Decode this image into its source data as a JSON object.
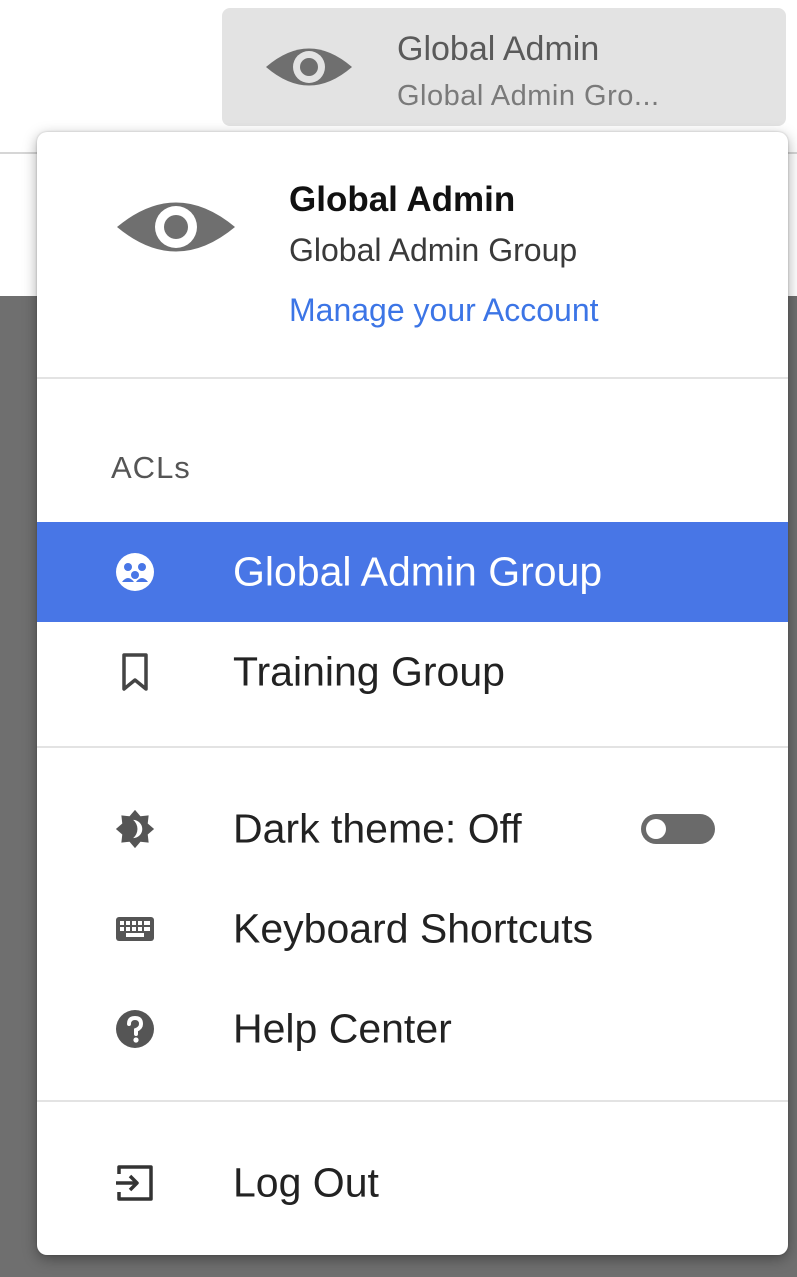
{
  "header": {
    "account_chip": {
      "name": "Global Admin",
      "group": "Global Admin Gro...",
      "icon": "eye-icon"
    }
  },
  "menu": {
    "profile": {
      "icon": "eye-icon",
      "name": "Global Admin",
      "group": "Global Admin Group",
      "manage_link": "Manage your Account"
    },
    "acls": {
      "label": "ACLs",
      "items": [
        {
          "label": "Global Admin Group",
          "icon": "group-icon",
          "selected": true
        },
        {
          "label": "Training Group",
          "icon": "bookmark-icon",
          "selected": false
        }
      ]
    },
    "settings": [
      {
        "label": "Dark theme: Off",
        "icon": "brightness-icon",
        "toggle": {
          "on": false
        }
      },
      {
        "label": "Keyboard Shortcuts",
        "icon": "keyboard-icon"
      },
      {
        "label": "Help Center",
        "icon": "help-icon"
      }
    ],
    "logout": {
      "label": "Log Out",
      "icon": "logout-icon"
    }
  },
  "colors": {
    "accent": "#4876e6",
    "link": "#3c75e6",
    "icon_gray": "#6f6f6f",
    "chip_bg": "#e3e3e3"
  }
}
